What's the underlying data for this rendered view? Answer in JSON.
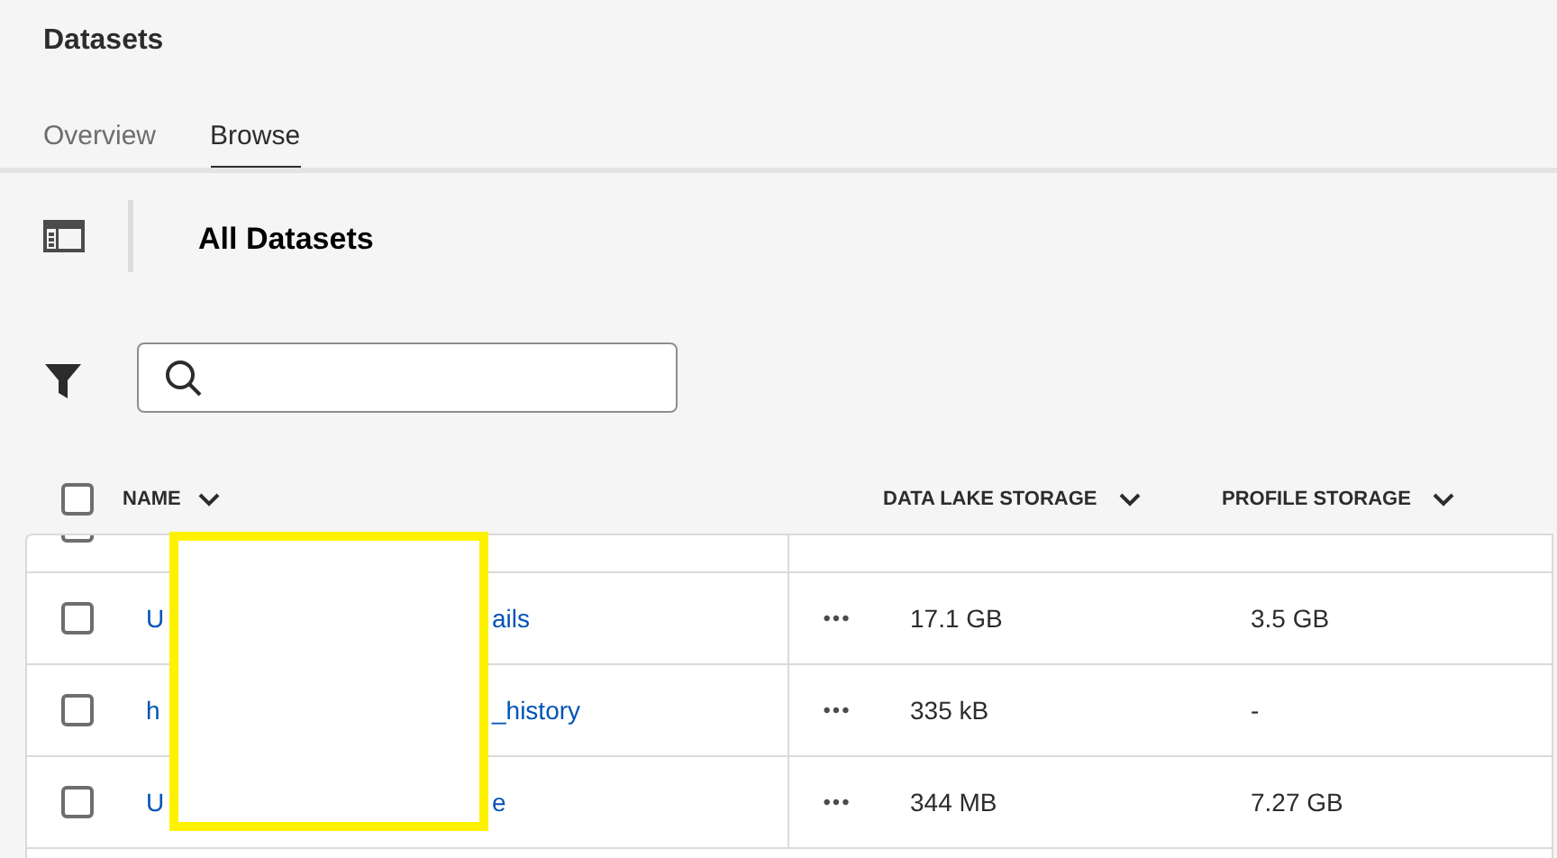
{
  "page_title": "Datasets",
  "tabs": [
    {
      "label": "Overview",
      "selected": false
    },
    {
      "label": "Browse",
      "selected": true
    }
  ],
  "section_title": "All Datasets",
  "table": {
    "select_all": {
      "checked": false
    },
    "columns": [
      {
        "label": "NAME"
      },
      {
        "label": "DATA LAKE STORAGE"
      },
      {
        "label": "PROFILE STORAGE"
      }
    ],
    "rows": [
      {
        "kind": "partial",
        "checked": false
      },
      {
        "kind": "full",
        "checked": false,
        "name_start": "U",
        "name_end": "ails",
        "actions": "•••",
        "data_lake": "17.1 GB",
        "profile": "3.5 GB"
      },
      {
        "kind": "full",
        "checked": false,
        "name_start": "h",
        "name_end": "_history",
        "actions": "•••",
        "data_lake": "335 kB",
        "profile": "-"
      },
      {
        "kind": "full",
        "checked": false,
        "name_start": "U",
        "name_end": "e",
        "actions": "•••",
        "data_lake": "344 MB",
        "profile": "7.27 GB"
      }
    ]
  }
}
